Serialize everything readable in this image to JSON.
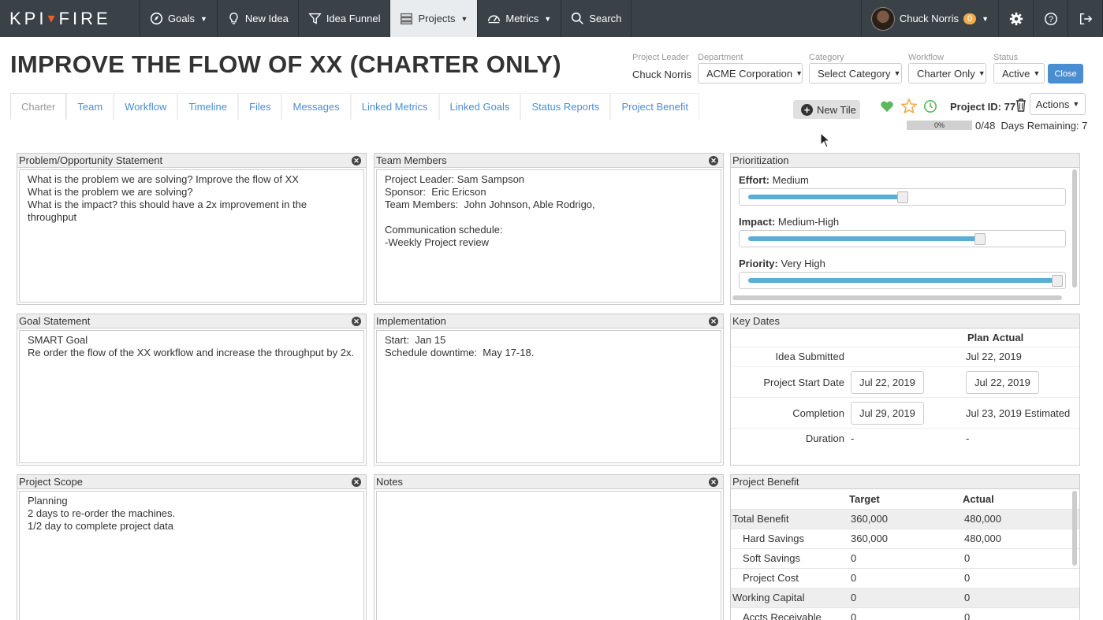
{
  "nav": {
    "logo_left": "KPI",
    "logo_right": "FIRE",
    "items": [
      {
        "label": "Goals",
        "icon": "compass-icon",
        "dropdown": true
      },
      {
        "label": "New Idea",
        "icon": "lightbulb-icon",
        "dropdown": false
      },
      {
        "label": "Idea Funnel",
        "icon": "funnel-icon",
        "dropdown": false
      },
      {
        "label": "Projects",
        "icon": "projects-icon",
        "dropdown": true,
        "active": true
      },
      {
        "label": "Metrics",
        "icon": "gauge-icon",
        "dropdown": true
      },
      {
        "label": "Search",
        "icon": "search-icon",
        "dropdown": false
      }
    ],
    "user_name": "Chuck Norris",
    "user_badge": "0"
  },
  "header": {
    "title": "IMPROVE THE FLOW OF XX (CHARTER ONLY)",
    "project_leader_label": "Project Leader",
    "project_leader": "Chuck Norris",
    "department_label": "Department",
    "department": "ACME Corporation",
    "category_label": "Category",
    "category": "Select Category",
    "workflow_label": "Workflow",
    "workflow": "Charter Only",
    "status_label": "Status",
    "status": "Active",
    "close_label": "Close"
  },
  "tabs": [
    "Charter",
    "Team",
    "Workflow",
    "Timeline",
    "Files",
    "Messages",
    "Linked Metrics",
    "Linked Goals",
    "Status Reports",
    "Project Benefit"
  ],
  "toolbar": {
    "new_tile_label": "New Tile",
    "project_id": "Project ID: 77",
    "actions_label": "Actions",
    "progress_percent": "0%",
    "progress_fraction": 0,
    "progress_count": "0/48",
    "days_remaining": "Days Remaining: 7"
  },
  "panels": {
    "problem": {
      "title": "Problem/Opportunity Statement",
      "body": "What is the problem we are solving? Improve the flow of XX\nWhat is the problem we are solving?\nWhat is the impact? this should have a 2x improvement in the throughput"
    },
    "team": {
      "title": "Team Members",
      "body": "Project Leader: Sam Sampson\nSponsor:  Eric Ericson\nTeam Members:  John Johnson, Able Rodrigo,\n\nCommunication schedule:\n-Weekly Project review"
    },
    "goal": {
      "title": "Goal Statement",
      "body": "SMART Goal\nRe order the flow of the XX workflow and increase the throughput by 2x."
    },
    "implementation": {
      "title": "Implementation",
      "body": "Start:  Jan 15\nSchedule downtime:  May 17-18."
    },
    "scope": {
      "title": "Project Scope",
      "body": "Planning\n2 days to re-order the machines.\n1/2 day to complete project data"
    },
    "notes": {
      "title": "Notes",
      "body": ""
    }
  },
  "prioritization": {
    "title": "Prioritization",
    "sliders": [
      {
        "label": "Effort:",
        "value": "Medium",
        "level": 0.5
      },
      {
        "label": "Impact:",
        "value": "Medium-High",
        "level": 0.75
      },
      {
        "label": "Priority:",
        "value": "Very High",
        "level": 1.0
      }
    ]
  },
  "key_dates": {
    "title": "Key Dates",
    "col_plan": "Plan",
    "col_actual": "Actual",
    "rows": [
      {
        "label": "Idea Submitted",
        "plan": "",
        "actual": "Jul 22, 2019"
      },
      {
        "label": "Project Start Date",
        "plan": "Jul 22, 2019",
        "actual": "Jul 22, 2019"
      },
      {
        "label": "Completion",
        "plan": "Jul 29, 2019",
        "actual": "Jul 23, 2019 Estimated"
      },
      {
        "label": "Duration",
        "plan": "-",
        "actual": "-"
      }
    ]
  },
  "benefit": {
    "title": "Project Benefit",
    "col_target": "Target",
    "col_actual": "Actual",
    "rows": [
      {
        "label": "Total Benefit",
        "target": "360,000",
        "actual": "480,000",
        "group": true
      },
      {
        "label": "Hard Savings",
        "target": "360,000",
        "actual": "480,000",
        "group": false
      },
      {
        "label": "Soft Savings",
        "target": "0",
        "actual": "0",
        "group": false
      },
      {
        "label": "Project Cost",
        "target": "0",
        "actual": "0",
        "group": false
      },
      {
        "label": "Working Capital",
        "target": "0",
        "actual": "0",
        "group": true
      },
      {
        "label": "Accts Receivable",
        "target": "0",
        "actual": "0",
        "group": false
      }
    ]
  },
  "colors": {
    "nav_bg": "#3a4147",
    "accent": "#4a8ed1",
    "slider": "#5aaed3",
    "heart": "#5cb85c",
    "star": "#f0ad4e"
  }
}
